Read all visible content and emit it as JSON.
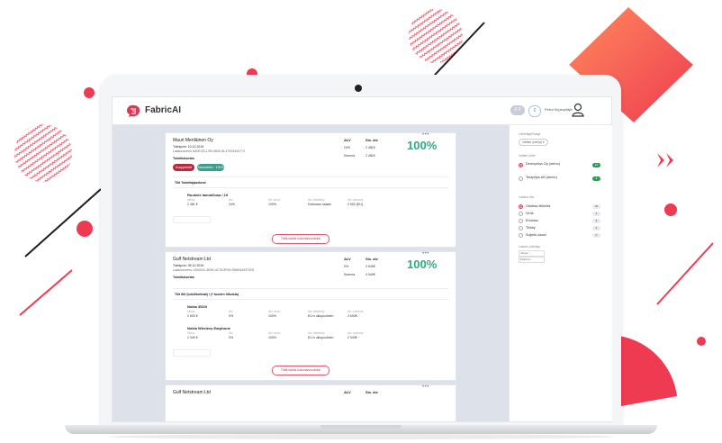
{
  "app": {
    "brand": "FabricAI",
    "header_pill_1": "0 0",
    "header_pill_2": "0",
    "user_name": "Petra Kirjanpitäjä"
  },
  "colors": {
    "accent": "#d83a52",
    "success": "#2cae7f",
    "decor_red": "#ee3b52",
    "decor_orange": "#f26a52"
  },
  "cards": [
    {
      "company": "Mauri Meriläinen Oy",
      "date_line": "Toimipvm: 10.12.2019",
      "invoice_line": "Laskunumero 8A0E/23-1/99-0606-IN-47923400773",
      "status_label": "Toimituksesta:",
      "btn_red": "Kuoppehdit",
      "btn_teal": "Tarkastettu · 100%",
      "col_alv": "ALV",
      "col_sis": "Sis. alv",
      "row1_alv": "24%",
      "row1_sis": "2 481€",
      "row2_label": "Summa",
      "row2_sis": "2 481€",
      "percent": "100%",
      "section_title": "Tilit Toimittajaseknot",
      "item_name": "Ruukvie lammillusa / 19",
      "item_h1": "Hinta",
      "item_h2": "Alv",
      "item_h3": "Alv arvio",
      "item_h4": "Alv käsittely",
      "item_h5": "Alv summa",
      "item_v1": "2 481 €",
      "item_v2": "24%",
      "item_v3": "100%",
      "item_v4": "Kotimaan osasto",
      "item_v5": "2 000 (EU)",
      "show_btn": "Tällä kaikki kokonaisuudeksi"
    },
    {
      "company": "Gulf Netstream Ltd",
      "date_line": "Toimipvm: 05.12.2019",
      "invoice_line": "Laskunumero U0U00/U-8090-4C76-9F05-0B6EA4947328",
      "status_label": "Toimituksesta:",
      "col_alv": "ALV",
      "col_sis": "Sis. alv",
      "row1_alv": "0%",
      "row1_sis": "4 940€",
      "row2_label": "Summa",
      "row2_sis": "4 940€",
      "percent": "100%",
      "section_title": "Tilit tilit (tuloihtoitmat) / (+ tuoden tiikoista)",
      "item1_name": "Nokia 3510i",
      "item1_v1": "2 600 €",
      "item1_v2": "0%",
      "item1_v3": "100%",
      "item1_v4": "EU:n ulkopuolinen",
      "item1_v5": "2 600€",
      "item2_name": "Nokia Wireless Earphone",
      "item2_v1": "2 340 €",
      "item2_v2": "0%",
      "item2_v3": "100%",
      "item2_v4": "EU:n ulkopuolinen",
      "item2_v5": "2 340€",
      "h1": "Hinta",
      "h2": "Alv",
      "h3": "Alv arvio",
      "h4": "Alv käsittely",
      "h5": "Alv summa",
      "show_btn": "Tällä kaikki kokonaisuudeksi"
    },
    {
      "company": "Gulf Netstream Ltd",
      "col_alv": "ALV",
      "col_sis": "Sis. alv"
    }
  ],
  "sidebar": {
    "section1_title": "Lähettäjä/Saaja",
    "filter_chip": "Valitse yhtiö(t) ▾",
    "section2_title": "Valitse yhtiö",
    "companies": [
      {
        "label": "Demoyritys Oy (demo)",
        "count": "16",
        "selected": true
      },
      {
        "label": "Testyritys AB (demo)",
        "count": "8",
        "selected": false
      }
    ],
    "section3_title": "Laskun tila",
    "statuses": [
      {
        "label": "Odottaa tiliöintiä",
        "count": "46",
        "selected": true
      },
      {
        "label": "Virhe",
        "count": "4",
        "selected": false
      },
      {
        "label": "Ehdotus",
        "count": "8",
        "selected": false
      },
      {
        "label": "Tiliöity",
        "count": "6",
        "selected": false
      },
      {
        "label": "Suljettu kausi",
        "count": "0",
        "selected": false
      }
    ],
    "section4_title": "Laskun päiväys",
    "date_from": "Alkaen",
    "date_to": "Päättyen"
  }
}
